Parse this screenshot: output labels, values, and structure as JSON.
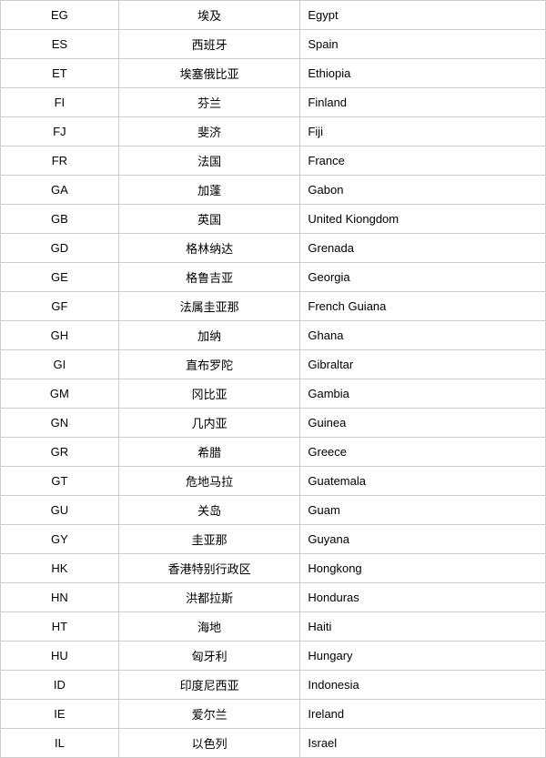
{
  "table": {
    "rows": [
      {
        "code": "EG",
        "chinese": "埃及",
        "english": "Egypt"
      },
      {
        "code": "ES",
        "chinese": "西班牙",
        "english": "Spain"
      },
      {
        "code": "ET",
        "chinese": "埃塞俄比亚",
        "english": "Ethiopia"
      },
      {
        "code": "FI",
        "chinese": "芬兰",
        "english": "Finland"
      },
      {
        "code": "FJ",
        "chinese": "斐济",
        "english": "Fiji"
      },
      {
        "code": "FR",
        "chinese": "法国",
        "english": "France"
      },
      {
        "code": "GA",
        "chinese": "加蓬",
        "english": "Gabon"
      },
      {
        "code": "GB",
        "chinese": "英国",
        "english": "United Kiongdom"
      },
      {
        "code": "GD",
        "chinese": "格林纳达",
        "english": "Grenada"
      },
      {
        "code": "GE",
        "chinese": "格鲁吉亚",
        "english": "Georgia"
      },
      {
        "code": "GF",
        "chinese": "法属圭亚那",
        "english": "French Guiana"
      },
      {
        "code": "GH",
        "chinese": "加纳",
        "english": "Ghana"
      },
      {
        "code": "GI",
        "chinese": "直布罗陀",
        "english": "Gibraltar"
      },
      {
        "code": "GM",
        "chinese": "冈比亚",
        "english": "Gambia"
      },
      {
        "code": "GN",
        "chinese": "几内亚",
        "english": "Guinea"
      },
      {
        "code": "GR",
        "chinese": "希腊",
        "english": "Greece"
      },
      {
        "code": "GT",
        "chinese": "危地马拉",
        "english": "Guatemala"
      },
      {
        "code": "GU",
        "chinese": "关岛",
        "english": "Guam"
      },
      {
        "code": "GY",
        "chinese": "圭亚那",
        "english": "Guyana"
      },
      {
        "code": "HK",
        "chinese": "香港特别行政区",
        "english": "Hongkong"
      },
      {
        "code": "HN",
        "chinese": "洪都拉斯",
        "english": "Honduras"
      },
      {
        "code": "HT",
        "chinese": "海地",
        "english": "Haiti"
      },
      {
        "code": "HU",
        "chinese": "匈牙利",
        "english": "Hungary"
      },
      {
        "code": "ID",
        "chinese": "印度尼西亚",
        "english": "Indonesia"
      },
      {
        "code": "IE",
        "chinese": "爱尔兰",
        "english": "Ireland"
      },
      {
        "code": "IL",
        "chinese": "以色列",
        "english": "Israel"
      }
    ]
  }
}
